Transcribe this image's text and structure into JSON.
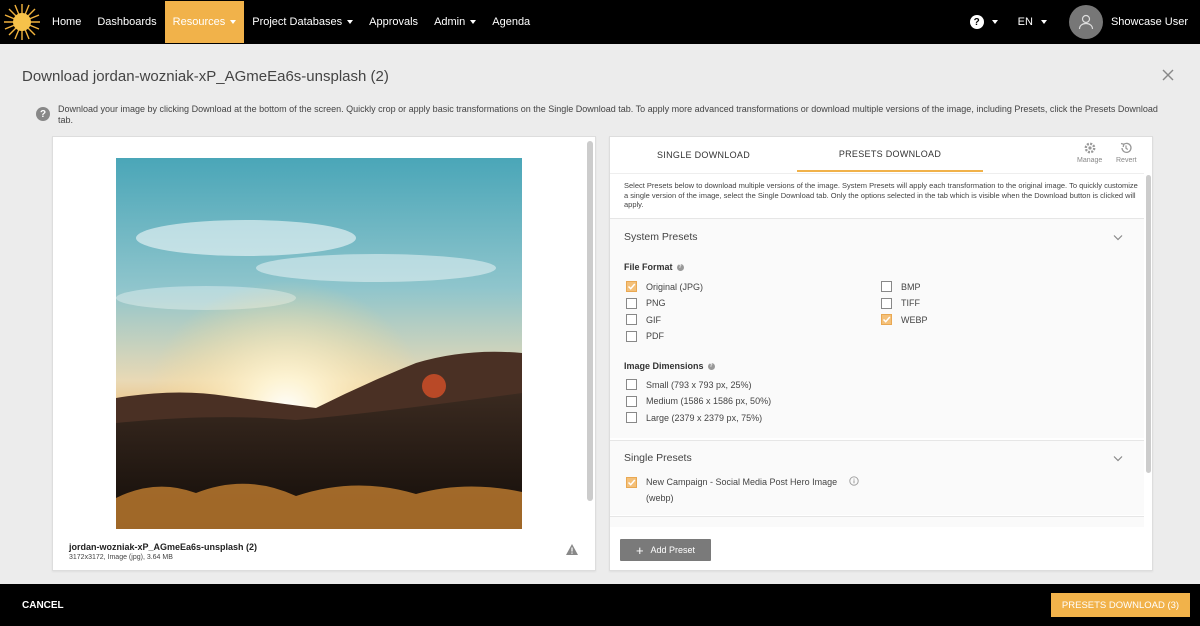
{
  "nav": {
    "items": [
      {
        "label": "Home",
        "dropdown": false,
        "active": false
      },
      {
        "label": "Dashboards",
        "dropdown": false,
        "active": false
      },
      {
        "label": "Resources",
        "dropdown": true,
        "active": true
      },
      {
        "label": "Project Databases",
        "dropdown": true,
        "active": false
      },
      {
        "label": "Approvals",
        "dropdown": false,
        "active": false
      },
      {
        "label": "Admin",
        "dropdown": true,
        "active": false
      },
      {
        "label": "Agenda",
        "dropdown": false,
        "active": false
      }
    ],
    "help_symbol": "?",
    "language": "EN",
    "user_name": "Showcase User",
    "accent_color": "#f1b24a"
  },
  "dialog": {
    "title": "Download jordan-wozniak-xP_AGmeEa6s-unsplash (2)",
    "info_text": "Download your image by clicking Download at the bottom of the screen. Quickly crop or apply basic transformations on the Single Download tab. To apply more advanced transformations or download multiple versions of the image, including Presets, click the Presets Download tab."
  },
  "preview": {
    "file_name": "jordan-wozniak-xP_AGmeEa6s-unsplash (2)",
    "file_meta": "3172x3172, Image (jpg), 3.64 MB"
  },
  "tabs": {
    "single": "SINGLE DOWNLOAD",
    "presets": "PRESETS DOWNLOAD",
    "manage": "Manage",
    "revert": "Revert"
  },
  "presets": {
    "description": "Select Presets below to download multiple versions of the image. System Presets will apply each transformation to the original image. To quickly customize a single version of the image, select the Single Download tab. Only the options selected in the tab which is visible when the Download button is clicked will apply.",
    "system_title": "System Presets",
    "file_format_label": "File Format",
    "formats_left": [
      {
        "label": "Original (JPG)",
        "checked": true
      },
      {
        "label": "PNG",
        "checked": false
      },
      {
        "label": "GIF",
        "checked": false
      },
      {
        "label": "PDF",
        "checked": false
      }
    ],
    "formats_right": [
      {
        "label": "BMP",
        "checked": false
      },
      {
        "label": "TIFF",
        "checked": false
      },
      {
        "label": "WEBP",
        "checked": true
      }
    ],
    "dimensions_label": "Image Dimensions",
    "dimensions": [
      {
        "label": "Small (793 x 793 px, 25%)",
        "checked": false
      },
      {
        "label": "Medium (1586 x 1586 px, 50%)",
        "checked": false
      },
      {
        "label": "Large (2379 x 2379 px, 75%)",
        "checked": false
      }
    ],
    "single_title": "Single Presets",
    "single_items": [
      {
        "label": "New Campaign - Social Media Post Hero Image",
        "sub": "(webp)",
        "checked": true
      }
    ],
    "add_preset": "Add Preset"
  },
  "footer": {
    "cancel": "CANCEL",
    "download": "PRESETS DOWNLOAD (3)"
  }
}
